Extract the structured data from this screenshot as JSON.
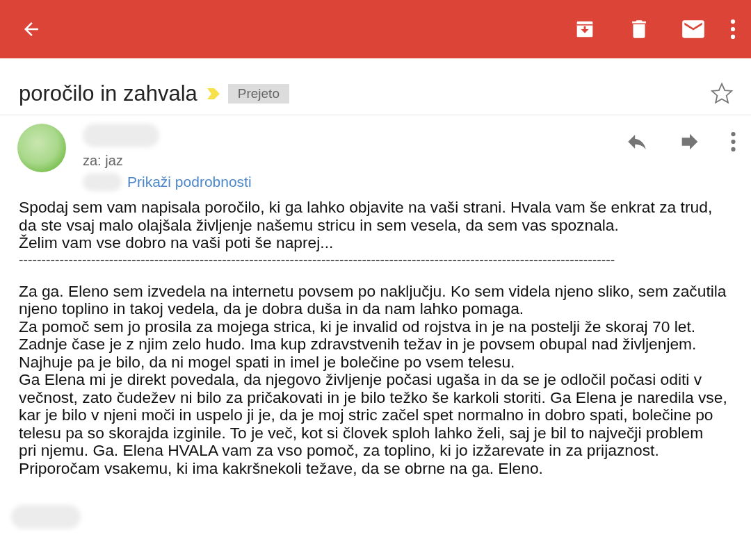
{
  "subject": "poročilo in zahvala",
  "label": "Prejeto",
  "starred": false,
  "recipient": "za: jaz",
  "details_link": "Prikaži podrobnosti",
  "intro": [
    "Spodaj sem vam napisala poročilo, ki ga lahko objavite na vaši strani. Hvala vam še enkrat za trud,",
    "da ste vsaj malo olajšala življenje našemu stricu in sem vesela, da sem vas spoznala.",
    "Želim vam vse dobro na vaši poti še naprej..."
  ],
  "separator": "------------------------------------------------------------------------------------------------------------------------------------",
  "body": [
    "Za ga. Eleno sem izvedela na internetu povsem po naključju. Ko sem videla njeno sliko, sem začutila",
    "njeno toplino in takoj vedela, da je dobra duša in da nam lahko pomaga.",
    "Za pomoč sem jo prosila za mojega strica, ki je invalid od rojstva in je na postelji že skoraj 70 let.",
    "Zadnje čase je z njim zelo hudo. Ima kup zdravstvenih težav in je povsem obupal nad življenjem.",
    "Najhuje pa je bilo, da ni mogel spati in imel je bolečine po vsem telesu.",
    "Ga Elena mi je direkt povedala, da njegovo življenje počasi ugaša in da se je odločil počasi oditi v",
    "večnost, zato čudežev ni bilo za pričakovati in je bilo težko še karkoli storiti. Ga Elena je naredila vse,",
    "kar je bilo v njeni moči in uspelo ji je, da je moj stric začel spet normalno in dobro spati, bolečine po",
    "telesu pa so skorajda izginile. To je več, kot si človek sploh lahko želi, saj je bil to največji problem",
    "pri njemu. Ga. Elena HVALA vam za vso pomoč, za toplino, ki jo izžarevate in za prijaznost.",
    "Priporočam vsakemu, ki ima kakršnekoli težave, da se obrne na ga. Eleno."
  ]
}
